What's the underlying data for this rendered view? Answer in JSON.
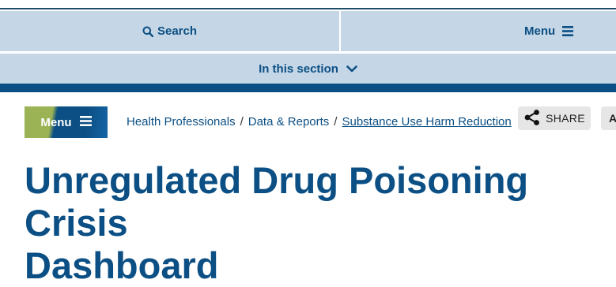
{
  "top_nav": {
    "search_label": "Search",
    "menu_label": "Menu"
  },
  "section_bar": {
    "label": "In this section"
  },
  "page_menu": {
    "label": "Menu"
  },
  "breadcrumb": {
    "items": [
      "Health Professionals",
      "Data & Reports",
      "Substance Use Harm Reduction"
    ],
    "separator": "/"
  },
  "actions": {
    "share_label": "SHARE",
    "extra_label": "A"
  },
  "page": {
    "title": "Unregulated Drug Poisoning Crisis\nDashboard"
  },
  "colors": {
    "primary": "#0b4f84",
    "nav_background": "#c5d6e6",
    "accent_green": "#9bb255"
  }
}
